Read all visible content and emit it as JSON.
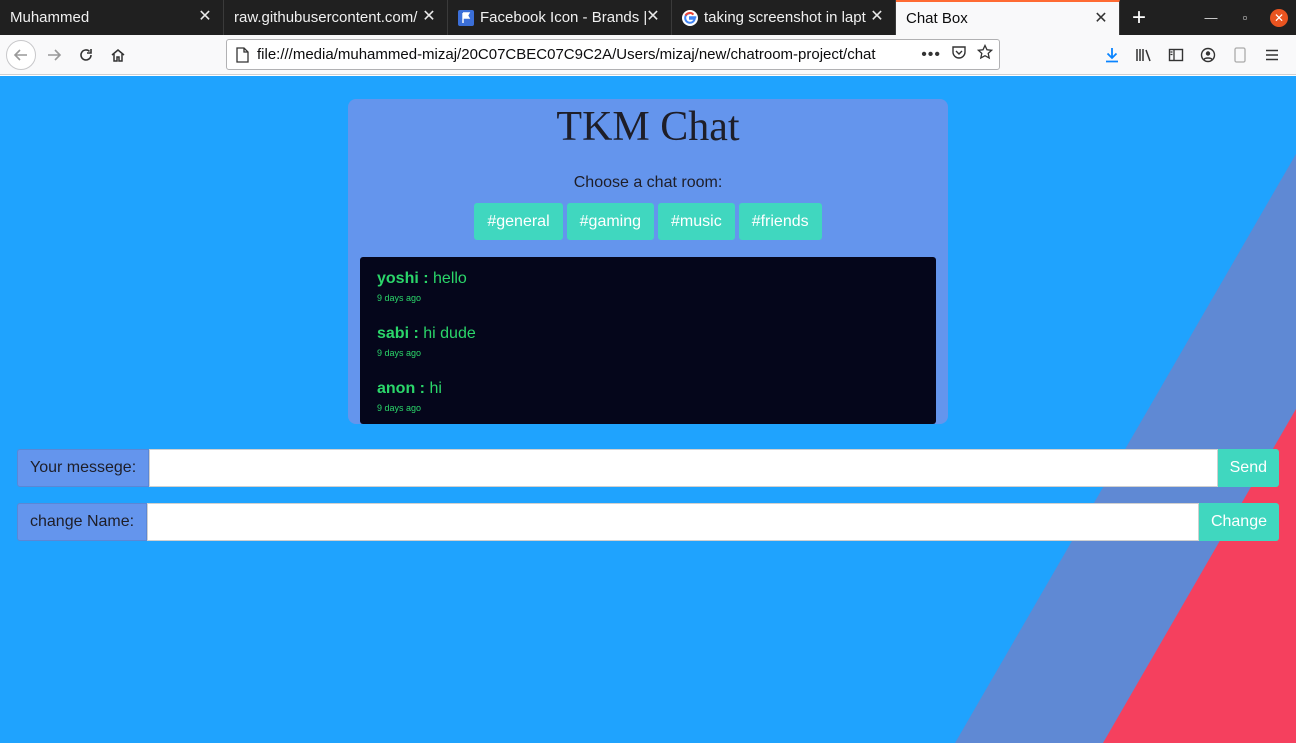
{
  "browser": {
    "tabs": [
      {
        "title": "Muhammed",
        "active": false
      },
      {
        "title": "raw.githubusercontent.com/",
        "active": false
      },
      {
        "title": "Facebook Icon - Brands |",
        "active": false
      },
      {
        "title": "taking screenshot in lapt",
        "active": false
      },
      {
        "title": "Chat Box",
        "active": true
      }
    ],
    "url": "file:///media/muhammed-mizaj/20C07CBEC07C9C2A/Users/mizaj/new/chatroom-project/chat"
  },
  "page": {
    "title": "TKM Chat",
    "room_prompt": "Choose a chat room:",
    "rooms": [
      "#general",
      "#gaming",
      "#music",
      "#friends"
    ],
    "messages": [
      {
        "name": "yoshi :",
        "text": "hello",
        "time": "9 days ago"
      },
      {
        "name": "sabi :",
        "text": "hi dude",
        "time": "9 days ago"
      },
      {
        "name": "anon :",
        "text": "hi",
        "time": "9 days ago"
      }
    ],
    "message_form": {
      "label": "Your messege:",
      "value": "",
      "button": "Send"
    },
    "name_form": {
      "label": "change Name:",
      "value": "",
      "button": "Change"
    }
  },
  "colors": {
    "background": "#1fa3fe",
    "card": "#6495ed",
    "accent": "#40d7bf",
    "chat_bg": "#05061b",
    "chat_text": "#2bd66a",
    "stripe_blue": "#5f89d4",
    "stripe_red": "#f5405e"
  }
}
